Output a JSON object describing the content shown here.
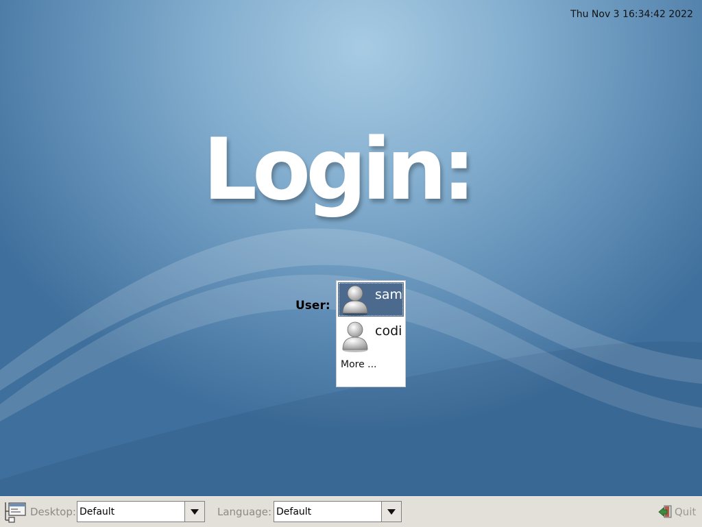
{
  "clock": {
    "text": "Thu Nov  3 16:34:42 2022"
  },
  "title": {
    "text": "Login:"
  },
  "user_prompt": {
    "label": "User:"
  },
  "users": [
    {
      "name": "sam",
      "selected": true,
      "icon": "user-avatar-icon"
    },
    {
      "name": "codi",
      "selected": false,
      "icon": "user-avatar-icon"
    }
  ],
  "more": {
    "label": "More ..."
  },
  "taskbar": {
    "menu_icon": "session-menu-icon",
    "desktop": {
      "label": "Desktop:",
      "value": "Default"
    },
    "language": {
      "label": "Language:",
      "value": "Default"
    },
    "quit": {
      "label": "Quit",
      "icon": "exit-icon"
    }
  },
  "colors": {
    "selected_bg": "#4b6a8d",
    "taskbar_bg": "#e3e0da",
    "background_center": "#a7cbe3",
    "background_edge": "#3f6f9c"
  }
}
